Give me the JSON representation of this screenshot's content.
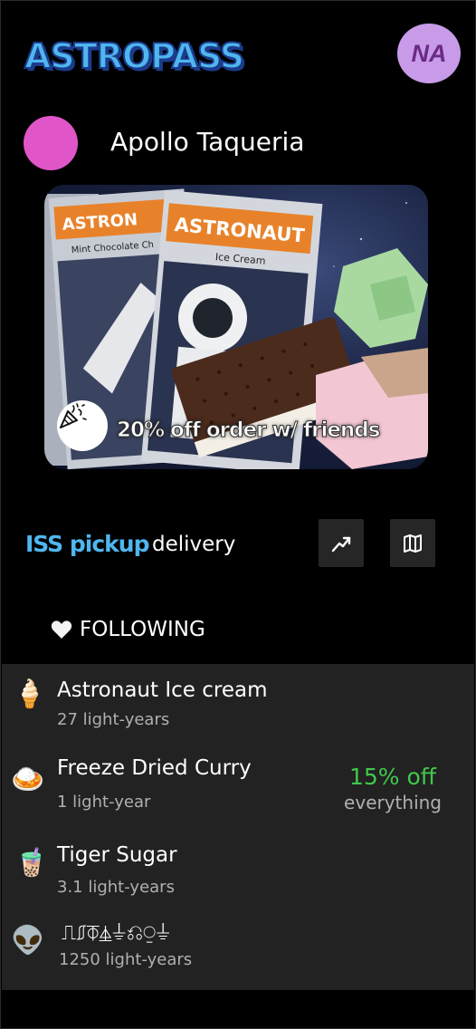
{
  "header": {
    "logo": "ASTROPASS",
    "avatar_initials": "NA"
  },
  "store": {
    "name": "Apollo Taqueria",
    "dot_color": "#e056c9"
  },
  "promo": {
    "text": "20% off order w/ friends",
    "icon": "party-popper-icon",
    "package_brand": "ASTRONAUT",
    "package_flavor": "Ice Cream",
    "package_side": "Mint Chocolate Ch",
    "package_back": "ASTRON"
  },
  "modes": {
    "active": "ISS pickup",
    "inactive": "delivery"
  },
  "actions": {
    "trending_icon": "trending-icon",
    "map_icon": "map-icon"
  },
  "following": {
    "icon": "heart-icon",
    "label": "FOLLOWING"
  },
  "list": [
    {
      "icon": "🍦",
      "icon_name": "soft-ice-cream-icon",
      "name": "Astronaut Ice cream",
      "distance": "27 light-years"
    },
    {
      "icon": "🍛",
      "icon_name": "curry-rice-icon",
      "name": "Freeze Dried Curry",
      "distance": "1 light-year",
      "deal": "15% off",
      "deal_sub": "everything"
    },
    {
      "icon": "🧋",
      "icon_name": "bubble-tea-icon",
      "name": "Tiger Sugar",
      "distance": "3.1 light-years"
    },
    {
      "icon": "👽",
      "icon_name": "alien-icon",
      "name": "⎍⎎⏁⏅⏚⎌⍜⏚",
      "distance": "1250 light-years"
    }
  ],
  "colors": {
    "accent": "#4fb6ef",
    "deal": "#3fc94b",
    "avatar": "#c79be8",
    "list_bg": "#222222"
  }
}
